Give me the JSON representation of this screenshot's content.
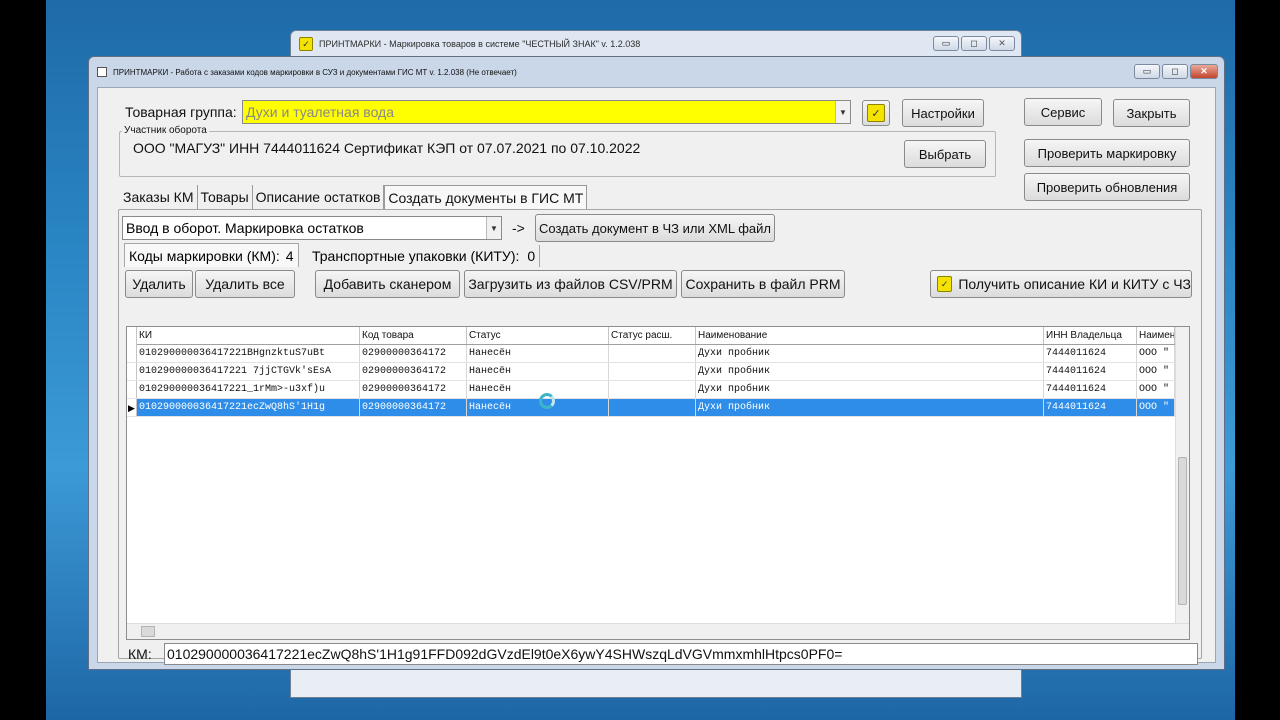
{
  "back_window": {
    "title": "ПРИНТМАРКИ - Маркировка товаров в системе \"ЧЕСТНЫЙ ЗНАК\"   v. 1.2.038"
  },
  "main_window": {
    "title": "ПРИНТМАРКИ  -  Работа с заказами кодов маркировки в СУЗ и документами ГИС МТ    v. 1.2.038 (Не отвечает)"
  },
  "window_controls": {
    "minimize": "▭",
    "maximize": "◻",
    "close": "✕"
  },
  "top": {
    "product_group_label": "Товарная группа:",
    "product_group_value": "Духи и туалетная вода",
    "settings_button": "Настройки",
    "service_button": "Сервис",
    "close_button": "Закрыть",
    "participant_legend": "Участник оборота",
    "participant_value": "ООО \"МАГУЗ\"  ИНН 7444011624 Сертификат КЭП от 07.07.2021 по 07.10.2022",
    "choose_button": "Выбрать",
    "check_marking_button": "Проверить маркировку",
    "check_updates_button": "Проверить обновления"
  },
  "tabs": [
    {
      "label": "Заказы КМ"
    },
    {
      "label": "Товары"
    },
    {
      "label": "Описание остатков"
    },
    {
      "label": "Создать документы в ГИС МТ"
    }
  ],
  "doc_type": {
    "value": "Ввод в оборот. Маркировка остатков",
    "arrow_text": "->",
    "create_button": "Создать документ в ЧЗ или XML файл"
  },
  "subtabs": {
    "km_label": "Коды маркировки (КМ):",
    "km_count": "4",
    "kitu_label": "Транспортные упаковки (КИТУ):",
    "kitu_count": "0"
  },
  "toolbar": {
    "delete": "Удалить",
    "delete_all": "Удалить все",
    "add_scanner": "Добавить сканером",
    "load_files": "Загрузить из файлов CSV/PRM",
    "save_prm": "Сохранить в файл PRM",
    "get_description": "Получить описание КИ и КИТУ с ЧЗ"
  },
  "grid": {
    "columns": [
      "КИ",
      "Код товара",
      "Статус",
      "Статус расш.",
      "Наименование",
      "ИНН Владельца",
      "Наимен"
    ],
    "rows": [
      [
        "010290000036417221BHgnzktuS7uBt",
        "02900000364172",
        "Нанесён",
        "",
        "Духи пробник",
        "7444011624",
        "ООО \""
      ],
      [
        "010290000036417221 7jjCTGVk'sEsA",
        "02900000364172",
        "Нанесён",
        "",
        "Духи пробник",
        "7444011624",
        "ООО \""
      ],
      [
        "010290000036417221_1rMm>-u3xf)u",
        "02900000364172",
        "Нанесён",
        "",
        "Духи пробник",
        "7444011624",
        "ООО \""
      ],
      [
        "010290000036417221ecZwQ8hS'1H1g",
        "02900000364172",
        "Нанесён",
        "",
        "Духи пробник",
        "7444011624",
        "ООО \""
      ]
    ],
    "selected_row": 3,
    "row_marker": "▶"
  },
  "km_field": {
    "label": "КМ:",
    "value": "010290000036417221ecZwQ8hS'1H1g91FFD092dGVzdEl9t0eX6ywY4SHWszqLdVGVmmxmhlHtpcs0PF0="
  },
  "colors": {
    "highlight_yellow": "#ffff00",
    "selection_blue": "#2e8de8"
  }
}
